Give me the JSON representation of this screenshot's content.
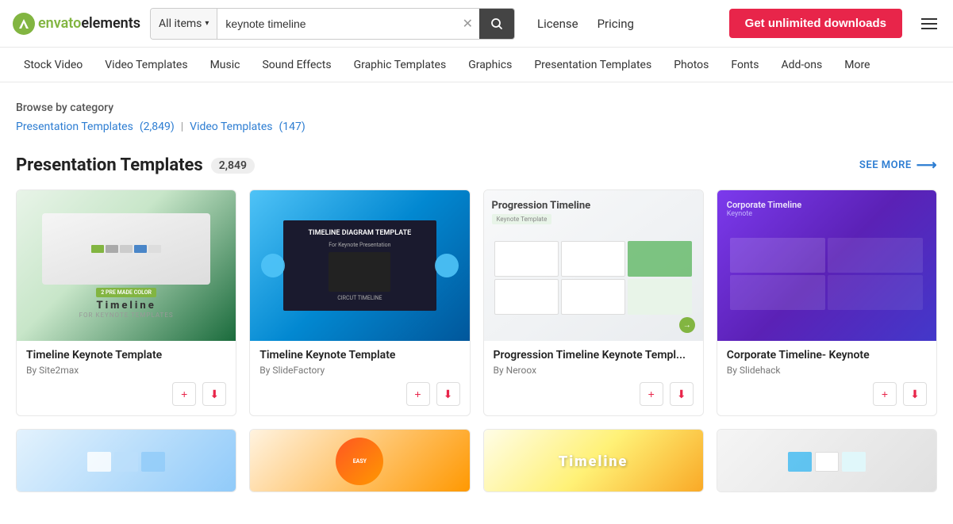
{
  "header": {
    "logo_text_envato": "envato",
    "logo_text_elements": "elements",
    "search_category": "All items",
    "search_value": "keynote timeline",
    "search_placeholder": "keynote timeline",
    "nav_license": "License",
    "nav_pricing": "Pricing",
    "cta_label": "Get unlimited downloads"
  },
  "category_nav": {
    "items": [
      {
        "label": "Stock Video",
        "id": "stock-video"
      },
      {
        "label": "Video Templates",
        "id": "video-templates"
      },
      {
        "label": "Music",
        "id": "music"
      },
      {
        "label": "Sound Effects",
        "id": "sound-effects"
      },
      {
        "label": "Graphic Templates",
        "id": "graphic-templates"
      },
      {
        "label": "Graphics",
        "id": "graphics"
      },
      {
        "label": "Presentation Templates",
        "id": "presentation-templates"
      },
      {
        "label": "Photos",
        "id": "photos"
      },
      {
        "label": "Fonts",
        "id": "fonts"
      },
      {
        "label": "Add-ons",
        "id": "add-ons"
      },
      {
        "label": "More",
        "id": "more"
      }
    ]
  },
  "browse": {
    "label": "Browse by category",
    "filters": [
      {
        "label": "Presentation Templates",
        "count": "(2,849)",
        "id": "pres"
      },
      {
        "label": "Video Templates",
        "count": "(147)",
        "id": "vid"
      }
    ],
    "separator": "|"
  },
  "presentation_section": {
    "title": "Presentation Templates",
    "count": "2,849",
    "see_more": "SEE MORE",
    "cards": [
      {
        "id": "card-1",
        "title": "Timeline Keynote Template",
        "author": "By Site2max",
        "badge": "2 PRE MADE COLOR",
        "subtitle": "Timeline"
      },
      {
        "id": "card-2",
        "title": "Timeline Keynote Template",
        "author": "By SlideFactory"
      },
      {
        "id": "card-3",
        "title": "Progression Timeline Keynote Templ...",
        "author": "By Neroox"
      },
      {
        "id": "card-4",
        "title": "Corporate Timeline- Keynote",
        "author": "By Slidehack"
      }
    ],
    "bottom_cards": [
      {
        "id": "card-5",
        "title": "",
        "author": ""
      },
      {
        "id": "card-6",
        "title": "",
        "author": ""
      },
      {
        "id": "card-7",
        "title": "",
        "author": ""
      },
      {
        "id": "card-8",
        "title": "",
        "author": ""
      }
    ]
  },
  "icons": {
    "search": "🔍",
    "clear": "✕",
    "chevron_down": "▾",
    "add": "+",
    "download": "⬇",
    "arrow_right": "→",
    "hamburger": "☰"
  }
}
